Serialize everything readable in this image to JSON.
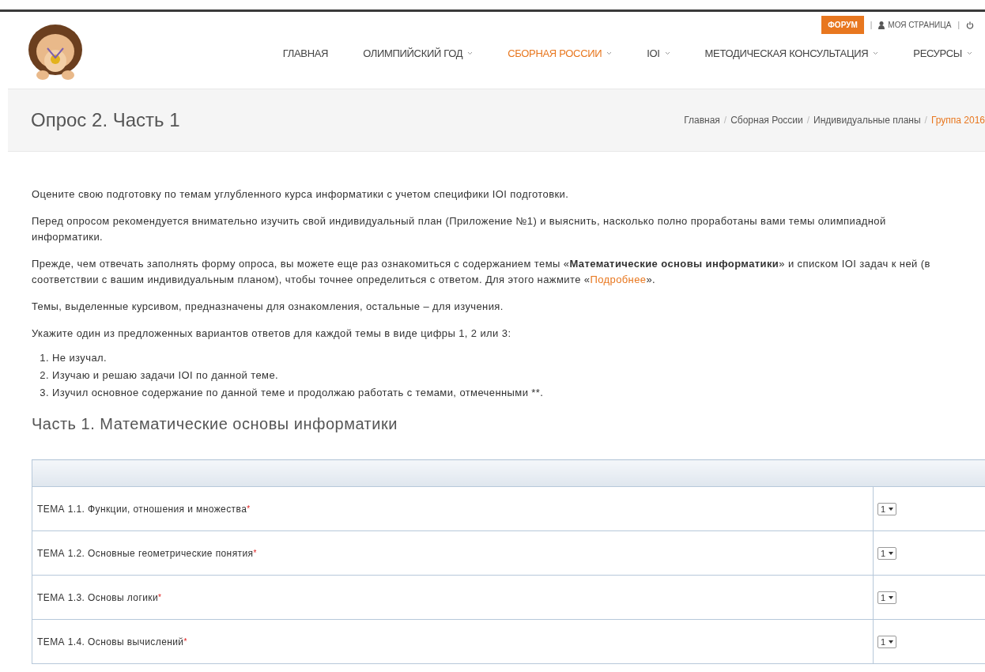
{
  "top_links": {
    "forum": "ФОРУМ",
    "separator": "|",
    "my_page": "МОЯ СТРАНИЦА"
  },
  "nav": [
    {
      "label": "ГЛАВНАЯ",
      "selected": false,
      "dropdown": false
    },
    {
      "label": "ОЛИМПИЙСКИЙ ГОД",
      "selected": false,
      "dropdown": true
    },
    {
      "label": "СБОРНАЯ РОССИИ",
      "selected": true,
      "dropdown": true
    },
    {
      "label": "IOI",
      "selected": false,
      "dropdown": true
    },
    {
      "label": "МЕТОДИЧЕСКАЯ КОНСУЛЬТАЦИЯ",
      "selected": false,
      "dropdown": true
    },
    {
      "label": "РЕСУРСЫ",
      "selected": false,
      "dropdown": true
    }
  ],
  "page_title": "Опрос 2. Часть 1",
  "breadcrumb": {
    "separator": "/",
    "items": [
      {
        "label": "Главная",
        "selected": false
      },
      {
        "label": "Сборная России",
        "selected": false
      },
      {
        "label": "Индивидуальные планы",
        "selected": false
      },
      {
        "label": "Группа 2016",
        "selected": true
      }
    ]
  },
  "paragraphs": [
    {
      "text": "Оцените свою подготовку по темам углубленного курса информатики с учетом специфики IOI подготовки."
    },
    {
      "text": "Перед опросом рекомендуется внимательно изучить свой индивидуальный план (Приложение №1) и выяснить, насколько полно проработаны вами темы олимпиадной информатики."
    },
    {
      "text": "Прежде, чем отвечать заполнять форму опроса, вы можете еще раз ознакомиться с содержанием темы «**Математические основы информатики**» и списком IOI задач к ней (в соответствии с вашим индивидуальным планом), чтобы точнее определиться с ответом. Для этого нажмите «",
      "link": "Подробнее",
      "after": "»."
    },
    {
      "text": "Темы, выделенные курсивом, предназначены для ознакомления, остальные – для изучения."
    },
    {
      "text": "Укажите один из предложенных вариантов ответов для каждой темы в виде цифры 1, 2 или 3:"
    }
  ],
  "options": [
    {
      "number": "1.",
      "text": "Не изучал."
    },
    {
      "number": "2.",
      "text": "Изучаю и решаю задачи IOI по данной теме."
    },
    {
      "number": "3.",
      "text": "Изучил основное содержание по данной теме и продолжаю работать с темами, отмеченными **."
    }
  ],
  "section_title": "Часть 1. Математические основы информатики",
  "table": {
    "rows": [
      {
        "topic": "ТЕМА 1.1. Функции, отношения и множества",
        "required_mark": "*",
        "value": "1"
      },
      {
        "topic": "ТЕМА 1.2. Основные геометрические понятия",
        "required_mark": "*",
        "value": "1"
      },
      {
        "topic": "ТЕМА 1.3. Основы логики",
        "required_mark": "*",
        "value": "1"
      },
      {
        "topic": "ТЕМА 1.4. Основы вычислений",
        "required_mark": "*",
        "value": "1"
      }
    ]
  }
}
